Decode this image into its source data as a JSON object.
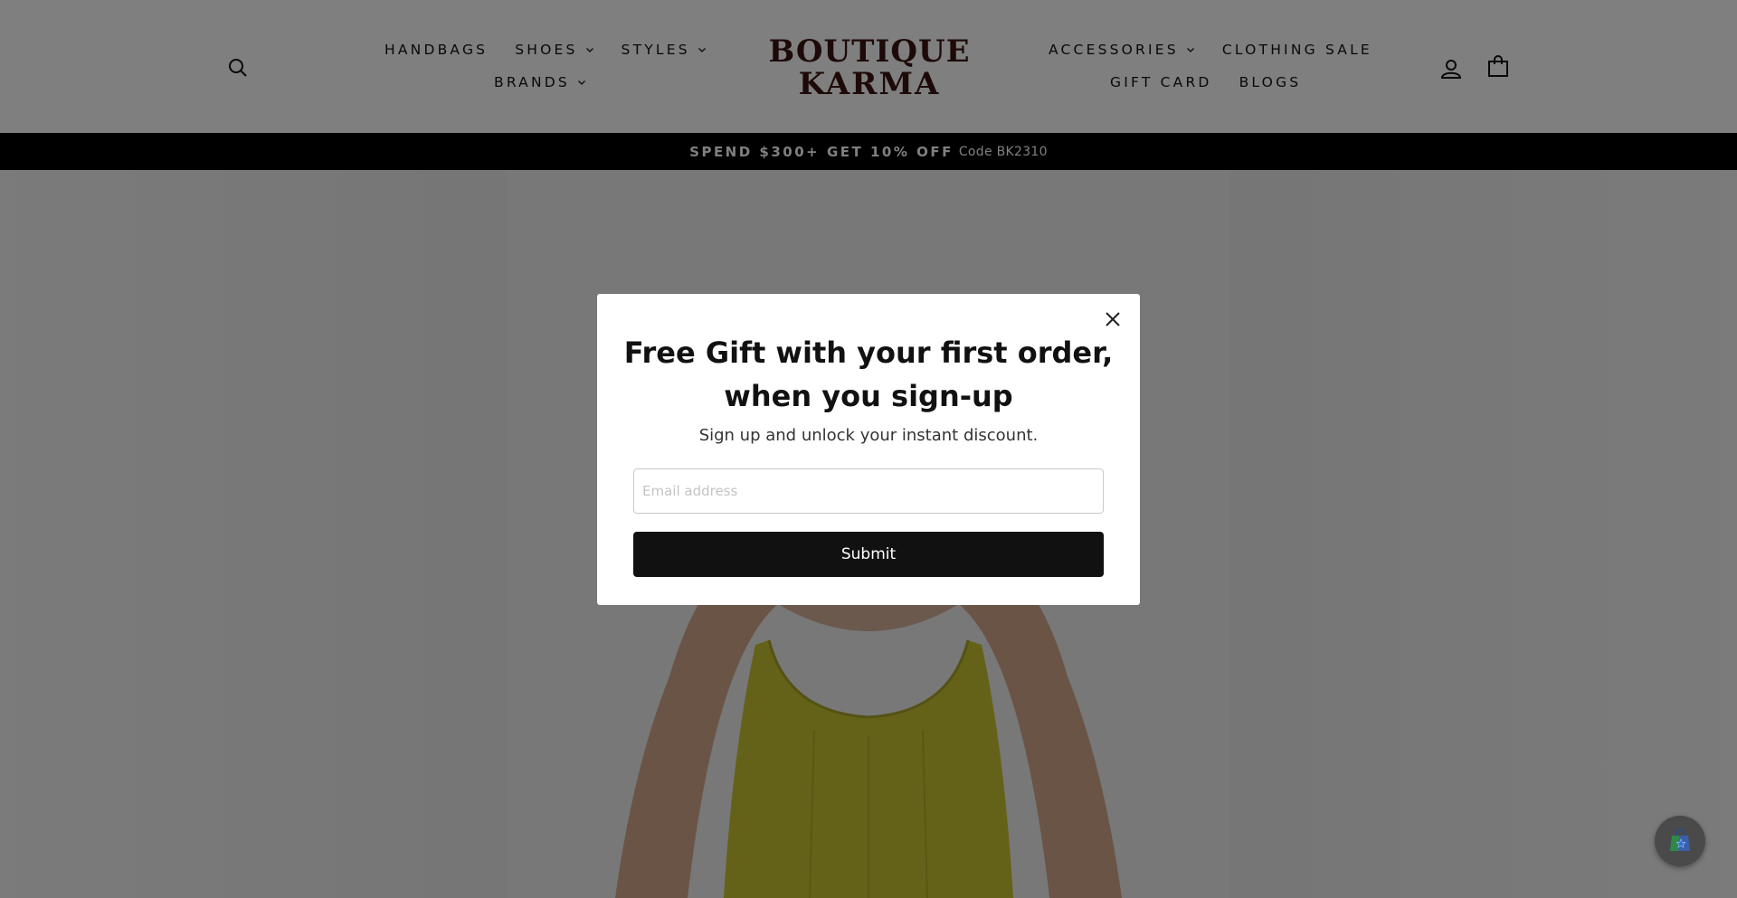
{
  "header": {
    "nav_left_row1": [
      {
        "label": "HANDBAGS",
        "has_dropdown": false
      },
      {
        "label": "SHOES",
        "has_dropdown": true
      },
      {
        "label": "STYLES",
        "has_dropdown": true
      }
    ],
    "nav_left_row2": [
      {
        "label": "BRANDS",
        "has_dropdown": true
      }
    ],
    "nav_right_row1": [
      {
        "label": "ACCESSORIES",
        "has_dropdown": true
      },
      {
        "label": "CLOTHING SALE",
        "has_dropdown": false
      }
    ],
    "nav_right_row2": [
      {
        "label": "GIFT CARD",
        "has_dropdown": false
      },
      {
        "label": "BLOGS",
        "has_dropdown": false
      }
    ],
    "logo": {
      "line1": "BOUTIQUE",
      "line2": "KARMA"
    },
    "icons": [
      "search-icon",
      "account-icon",
      "cart-icon"
    ]
  },
  "announcement": {
    "headline": "SPEND $300+ GET 10% OFF",
    "code": "Code BK2310"
  },
  "modal": {
    "title_line1": "Free Gift with your first order,",
    "title_line2": "when you sign-up",
    "subtitle": "Sign up and unlock your instant discount.",
    "email_placeholder": "Email address",
    "email_value": "",
    "submit_label": "Submit"
  },
  "colors": {
    "overlay": "rgba(0,0,0,0.5)",
    "announcement_bg": "#000000",
    "button_bg": "#111111",
    "logo": "#3a1410",
    "dress": "#c8c430"
  }
}
